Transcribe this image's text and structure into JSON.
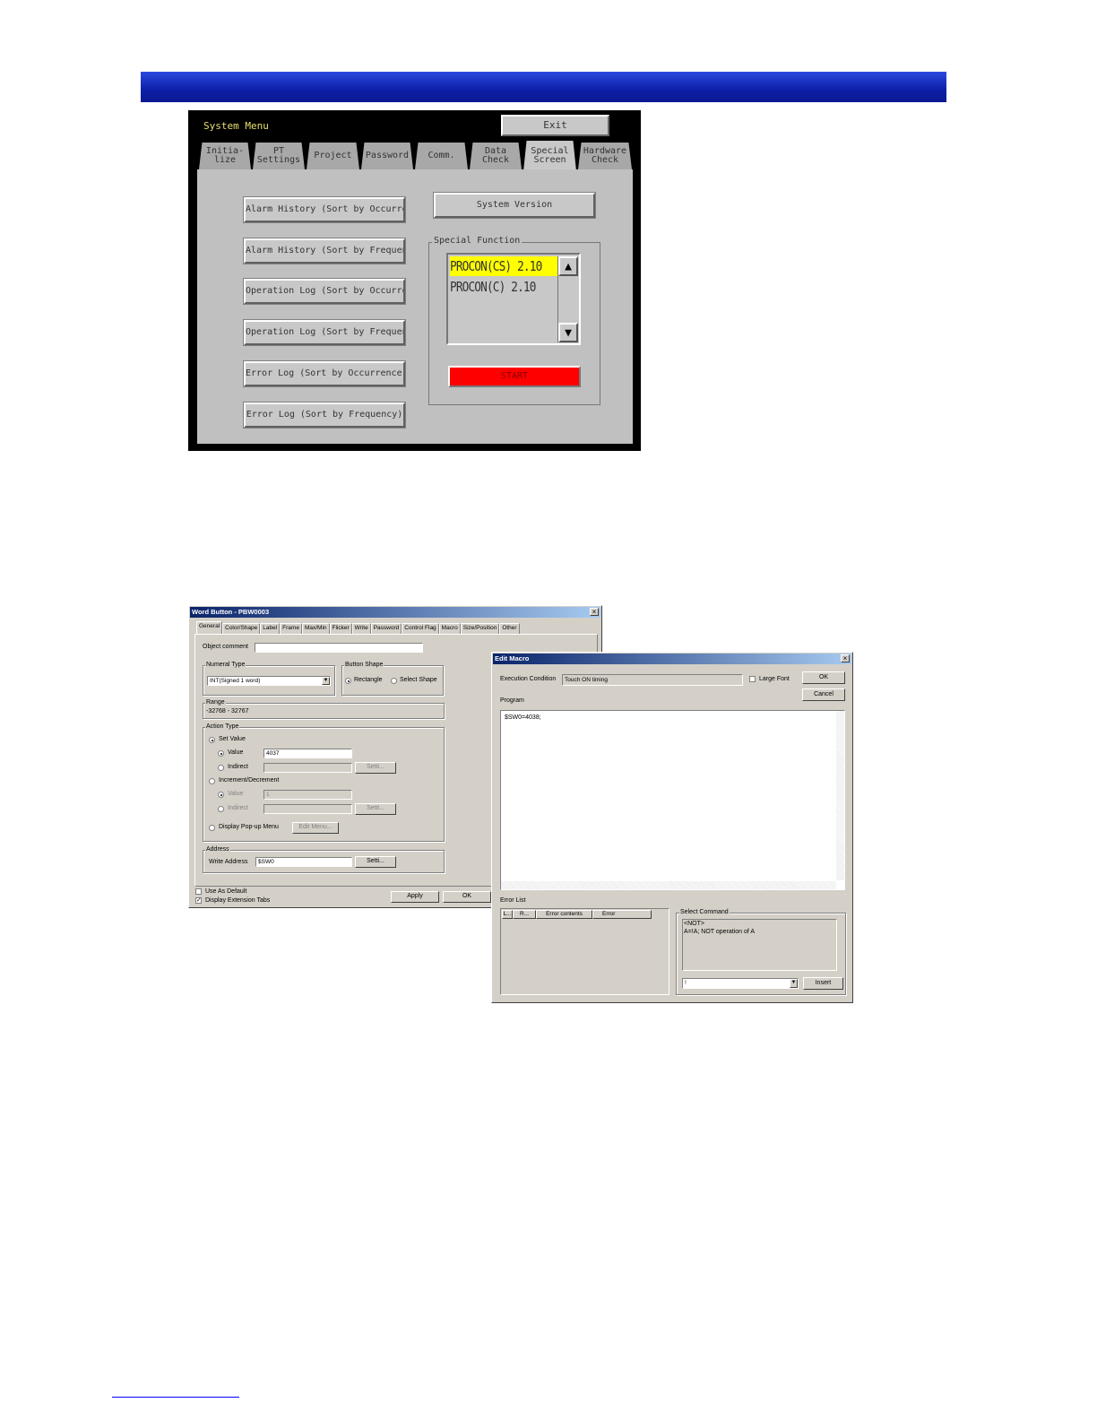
{
  "system_menu": {
    "title": "System Menu",
    "exit_label": "Exit",
    "tabs": [
      {
        "line1": "Initia-",
        "line2": "lize"
      },
      {
        "line1": "PT",
        "line2": "Settings"
      },
      {
        "line1": "Project",
        "line2": ""
      },
      {
        "line1": "Password",
        "line2": ""
      },
      {
        "line1": "Comm.",
        "line2": ""
      },
      {
        "line1": "Data",
        "line2": "Check"
      },
      {
        "line1": "Special",
        "line2": "Screen"
      },
      {
        "line1": "Hardware",
        "line2": "Check"
      }
    ],
    "active_tab": "Special Screen",
    "buttons": [
      "Alarm History (Sort by Occurrence)",
      "Alarm History (Sort by Frequency)",
      "Operation Log (Sort by Occurrence)",
      "Operation Log (Sort by Frequency)",
      "Error Log (Sort by Occurrence)",
      "Error Log (Sort by Frequency)"
    ],
    "system_version_label": "System Version",
    "special_function_label": "Special Function",
    "special_function_items": [
      "PROCON(CS) 2.10",
      "PROCON(C) 2.10"
    ],
    "selected_item": "PROCON(CS) 2.10",
    "start_label": "START",
    "colors": {
      "highlight": "#ffff00",
      "start": "#ff0000",
      "title": "#e8e070"
    }
  },
  "word_button": {
    "title": "Word Button - PBW0003",
    "tabs": [
      "General",
      "Color/Shape",
      "Label",
      "Frame",
      "Max/Min",
      "Flicker",
      "Write",
      "Password",
      "Control Flag",
      "Macro",
      "Size/Position",
      "Other"
    ],
    "object_comment_label": "Object comment",
    "object_comment_value": "",
    "numeral_type_label": "Numeral Type",
    "numeral_type_value": "INT(Signed 1 word)",
    "button_shape_label": "Button Shape",
    "shape_rectangle": "Rectangle",
    "shape_select": "Select Shape",
    "range_label": "Range",
    "range_value": "-32768 - 32767",
    "action_type_label": "Action Type",
    "set_value_label": "Set Value",
    "value_label": "Value",
    "value_value": "4037",
    "indirect_label": "Indirect",
    "setting_label": "Setti...",
    "inc_dec_label": "Increment/Decrement",
    "inc_value_label": "Value",
    "inc_value_value": "1",
    "inc_indirect_label": "Indirect",
    "inc_setting_label": "Setti...",
    "popup_menu_label": "Display Pop-up Menu",
    "edit_menu_label": "Edit Menu...",
    "address_label": "Address",
    "write_address_label": "Write Address",
    "write_address_value": "$SW0",
    "address_setting_label": "Setti...",
    "use_default_label": "Use As Default",
    "display_ext_label": "Display Extension Tabs",
    "apply_label": "Apply",
    "ok_label": "OK"
  },
  "edit_macro": {
    "title": "Edit Macro",
    "exec_condition_label": "Execution Condition",
    "exec_condition_value": "Touch ON timing",
    "large_font_label": "Large Font",
    "ok_label": "OK",
    "cancel_label": "Cancel",
    "program_label": "Program",
    "program_text": "$SW0=4038;",
    "error_list_label": "Error List",
    "error_columns": [
      "L...",
      "R...",
      "Error contents",
      "Error"
    ],
    "select_command_label": "Select Command",
    "command_line1": "<NOT>",
    "command_line2": "A=!A; NOT operation of A",
    "command_select_value": "!",
    "insert_label": "Insert"
  }
}
